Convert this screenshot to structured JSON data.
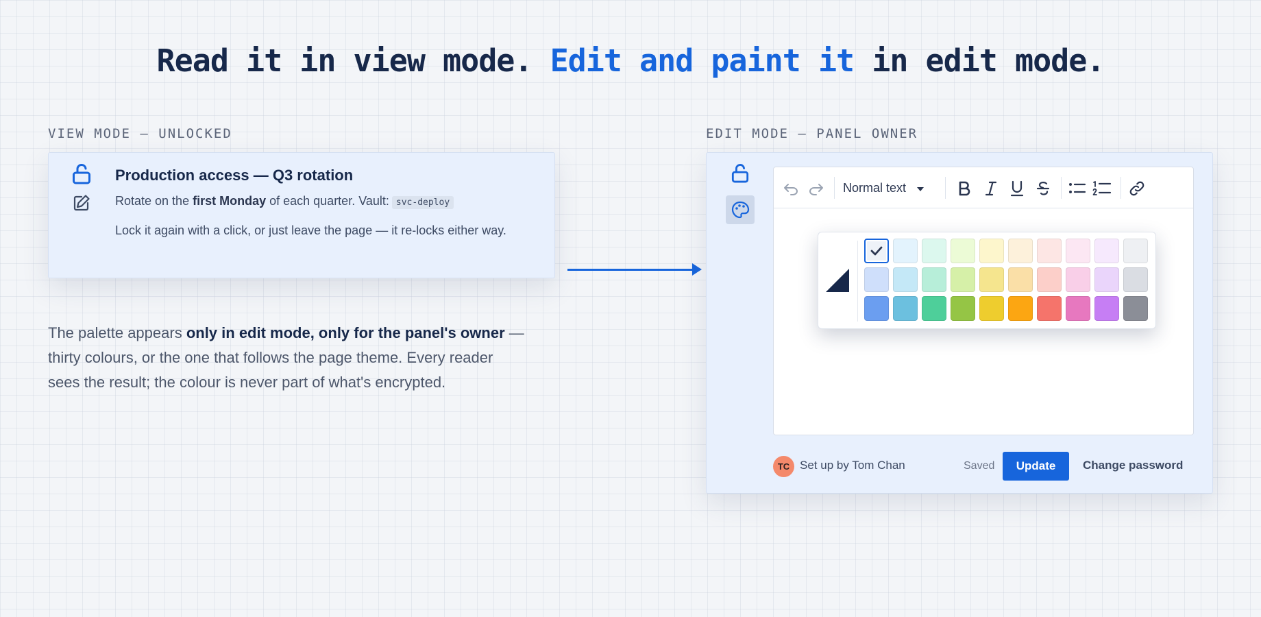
{
  "headline": {
    "part1": "Read it in view mode. ",
    "highlight": "Edit and paint it",
    "part2": " in edit mode."
  },
  "view": {
    "section_label": "VIEW MODE — UNLOCKED",
    "title": "Production access — Q3 rotation",
    "line1_pre": "Rotate on the ",
    "line1_bold": "first Monday",
    "line1_post": " of each quarter. Vault:",
    "code": "svc-deploy",
    "line2": "Lock it again with a click, or just leave the page — it re-locks either way."
  },
  "description": {
    "pre": "The palette appears ",
    "bold": "only in edit mode, only for the panel's owner",
    "post": " — thirty colours, or the one that follows the page theme. Every reader sees the result; the colour is never part of what's encrypted."
  },
  "edit": {
    "section_label": "EDIT MODE — PANEL OWNER",
    "toolbar": {
      "block_style": "Normal text",
      "icons": [
        "undo-icon",
        "redo-icon",
        "bold-icon",
        "italic-icon",
        "underline-icon",
        "strikethrough-icon",
        "bullet-list-icon",
        "numbered-list-icon",
        "link-icon"
      ]
    },
    "palette": {
      "selected_index": 0,
      "theme_swatch_colors": [
        "#ffffff",
        "#17284a"
      ],
      "rows": [
        [
          "#eef2f8",
          "#e3f3fd",
          "#dcf8ee",
          "#ecfbd6",
          "#fdf6cc",
          "#fdf1db",
          "#fde6e4",
          "#fce7f3",
          "#f6e9fd",
          "#eef0f3"
        ],
        [
          "#cfdffb",
          "#c4e8f7",
          "#b7eed9",
          "#d6f0a8",
          "#f5e58e",
          "#fadfa7",
          "#fccfc9",
          "#f9cfe8",
          "#ead5fb",
          "#dadde3"
        ],
        [
          "#6b9ef0",
          "#6cc0df",
          "#4ecf9a",
          "#95c545",
          "#eecd2e",
          "#fca612",
          "#f5746b",
          "#e778bf",
          "#c67ef4",
          "#8b8e97"
        ]
      ]
    },
    "footer": {
      "avatar_initials": "TC",
      "setup_text": "Set up by Tom Chan",
      "saved_text": "Saved",
      "update_label": "Update",
      "change_password_label": "Change password"
    }
  },
  "colors": {
    "accent": "#1765dc",
    "ink": "#17284a"
  }
}
